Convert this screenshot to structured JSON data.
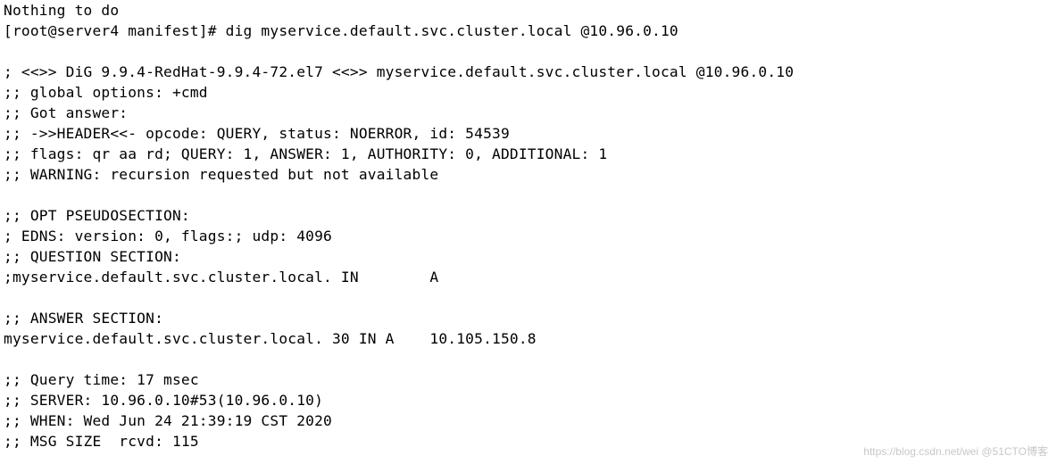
{
  "lines": {
    "l0": "Nothing to do",
    "l1": "[root@server4 manifest]# dig myservice.default.svc.cluster.local @10.96.0.10",
    "l2": "",
    "l3": "; <<>> DiG 9.9.4-RedHat-9.9.4-72.el7 <<>> myservice.default.svc.cluster.local @10.96.0.10",
    "l4": ";; global options: +cmd",
    "l5": ";; Got answer:",
    "l6": ";; ->>HEADER<<- opcode: QUERY, status: NOERROR, id: 54539",
    "l7": ";; flags: qr aa rd; QUERY: 1, ANSWER: 1, AUTHORITY: 0, ADDITIONAL: 1",
    "l8": ";; WARNING: recursion requested but not available",
    "l9": "",
    "l10": ";; OPT PSEUDOSECTION:",
    "l11": "; EDNS: version: 0, flags:; udp: 4096",
    "l12": ";; QUESTION SECTION:",
    "l13": ";myservice.default.svc.cluster.local. IN        A",
    "l14": "",
    "l15": ";; ANSWER SECTION:",
    "l16": "myservice.default.svc.cluster.local. 30 IN A    10.105.150.8",
    "l17": "",
    "l18": ";; Query time: 17 msec",
    "l19": ";; SERVER: 10.96.0.10#53(10.96.0.10)",
    "l20": ";; WHEN: Wed Jun 24 21:39:19 CST 2020",
    "l21": ";; MSG SIZE  rcvd: 115"
  },
  "watermark": "https://blog.csdn.net/wei @51CTO博客"
}
